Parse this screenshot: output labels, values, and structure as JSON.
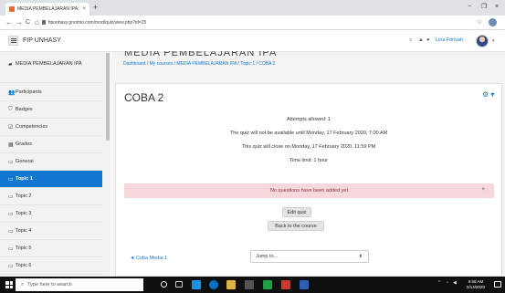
{
  "browser": {
    "tab_title": "MEDIA PEMBELAJARAN IPA: CC",
    "tab_close": "×",
    "new_tab": "+",
    "minimize": "−",
    "restore": "❐",
    "url": "fipunhasy.gnomio.com/mod/quiz/view.php?id=25",
    "back": "←",
    "forward": "→",
    "reload": "C",
    "home": "⌂",
    "star": "☆"
  },
  "navbar": {
    "site_name": "FIP UNHASY",
    "user_name": "Lina Fitriyah"
  },
  "sidebar": {
    "course": "MEDIA PEMBELAJARAN IPA",
    "items": [
      {
        "label": "Participants",
        "icon": "users-icon",
        "glyph": "👥"
      },
      {
        "label": "Badges",
        "icon": "badge-icon",
        "glyph": "⛉"
      },
      {
        "label": "Competencies",
        "icon": "check-icon",
        "glyph": "☑"
      },
      {
        "label": "Grades",
        "icon": "table-icon",
        "glyph": "▦"
      },
      {
        "label": "General",
        "icon": "folder-icon",
        "glyph": "▭"
      },
      {
        "label": "Topic 1",
        "icon": "folder-icon",
        "glyph": "▭"
      },
      {
        "label": "Topic 2",
        "icon": "folder-icon",
        "glyph": "▭"
      },
      {
        "label": "Topic 3",
        "icon": "folder-icon",
        "glyph": "▭"
      },
      {
        "label": "Topic 4",
        "icon": "folder-icon",
        "glyph": "▭"
      },
      {
        "label": "Topic 5",
        "icon": "folder-icon",
        "glyph": "▭"
      },
      {
        "label": "Topic 6",
        "icon": "folder-icon",
        "glyph": "▭"
      }
    ],
    "active_index": 5
  },
  "header": {
    "course_title_clipped": "MEDIA PEMBELAJARAN IPA"
  },
  "breadcrumb": {
    "dashboard": "Dashboard",
    "sep": " / ",
    "my_courses": "My courses",
    "course": "MEDIA PEMBELAJARAN IPA",
    "topic": "Topic 1",
    "current": "COBA 2"
  },
  "quiz": {
    "title": "COBA 2",
    "attempts": "Attempts allowed: 1",
    "available": "The quiz will not be available until Monday, 17 February 2020, 7:00 AM",
    "closes": "This quiz will close on Monday, 17 February 2020, 11:59 PM",
    "time_limit": "Time limit: 1 hour",
    "alert": "No questions have been added yet",
    "alert_close": "×",
    "edit_button": "Edit quiz",
    "back_button": "Back to the course",
    "prev_link": "◄ Coba Media 1",
    "jump_placeholder": "Jump to...",
    "jump_caret": "⬍"
  },
  "taskbar": {
    "search_placeholder": "Type here to search",
    "time": "9:59 AM",
    "date": "2/14/2020"
  },
  "colors": {
    "accent": "#1177d1",
    "alert_bg": "#f6d7dc",
    "sidebar_bg": "#f2f2f2",
    "taskbar": "#101010"
  }
}
